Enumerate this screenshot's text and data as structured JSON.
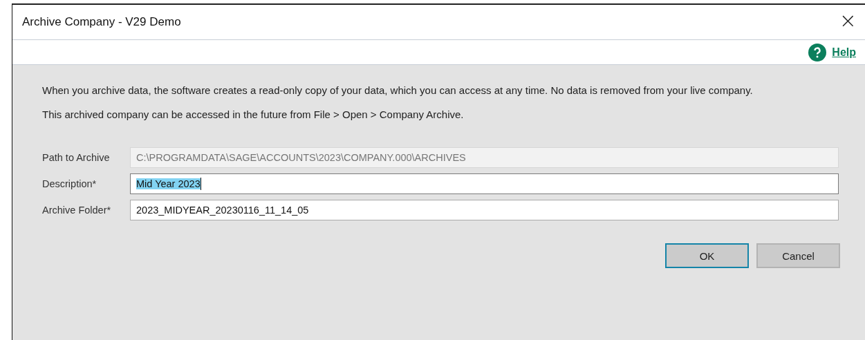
{
  "window": {
    "title": "Archive Company - V29 Demo",
    "close": "×"
  },
  "help": {
    "label": "Help"
  },
  "paragraphs": [
    "When you archive data, the software creates a read-only copy of your data, which you can access at any time. No data is removed from your live company.",
    "This archived company can be accessed in the future from File > Open > Company Archive."
  ],
  "fields": [
    {
      "label": "Path to Archive",
      "value": "C:\\PROGRAMDATA\\SAGE\\ACCOUNTS\\2023\\COMPANY.000\\ARCHIVES",
      "disabled": true,
      "text_selected": false
    },
    {
      "label": "Description*",
      "value": "Mid Year 2023",
      "disabled": false,
      "text_selected": true
    },
    {
      "label": "Archive Folder*",
      "value": "2023_MIDYEAR_20230116_11_14_05",
      "disabled": false,
      "text_selected": false
    }
  ],
  "buttons": [
    {
      "label": "OK",
      "default": true
    },
    {
      "label": "Cancel",
      "default": false
    }
  ]
}
